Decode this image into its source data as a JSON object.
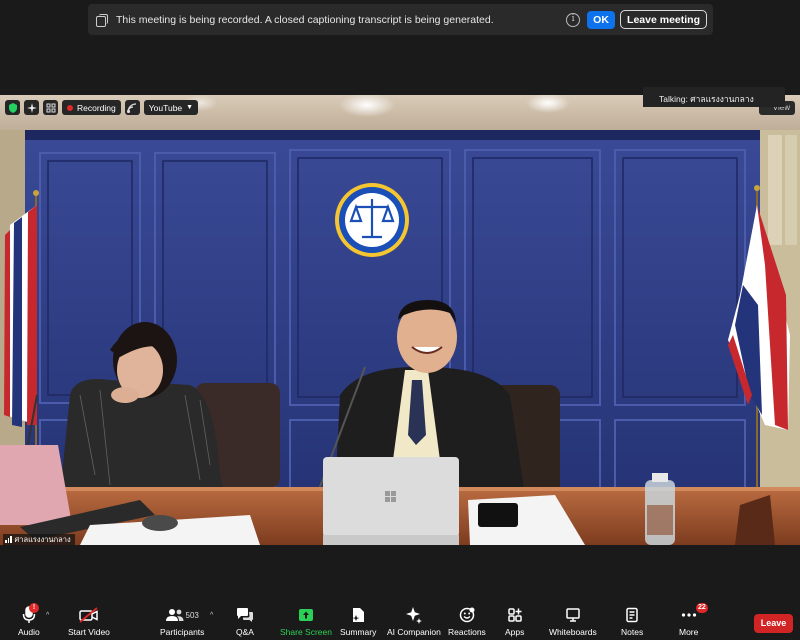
{
  "banner": {
    "message": "This meeting is being recorded. A closed captioning transcript is being generated.",
    "ok_label": "OK",
    "leave_label": "Leave meeting"
  },
  "video_bar": {
    "recording_label": "Recording",
    "youtube_label": "YouTube",
    "view_label": "View"
  },
  "talking": {
    "label": "Talking:",
    "name": "ศาลแรงงานกลาง"
  },
  "participant_name": "ศาลแรงงานกลาง",
  "toolbar": {
    "audio": "Audio",
    "audio_badge": "!",
    "start_video": "Start Video",
    "participants": "Participants",
    "participants_count": "503",
    "qa": "Q&A",
    "share_screen": "Share Screen",
    "summary": "Summary",
    "ai_companion": "AI Companion",
    "reactions": "Reactions",
    "apps": "Apps",
    "whiteboards": "Whiteboards",
    "notes": "Notes",
    "more": "More",
    "more_badge": "22",
    "leave": "Leave"
  },
  "colors": {
    "accent_blue": "#0e72ed",
    "leave_red": "#d12424",
    "share_green": "#2bd157",
    "wall_blue": "#2c3a7a"
  }
}
